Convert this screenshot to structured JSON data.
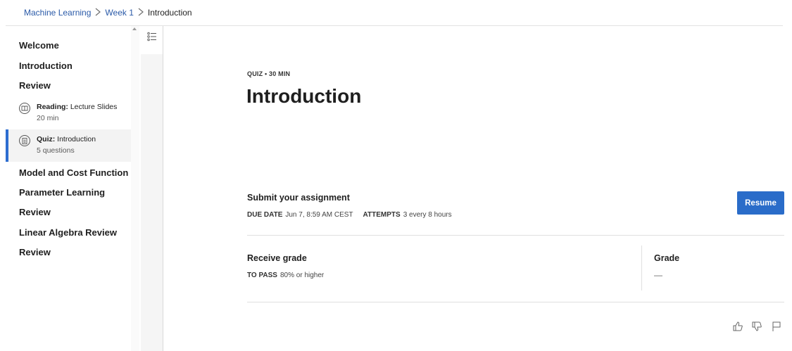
{
  "breadcrumb": {
    "items": [
      "Machine Learning",
      "Week 1"
    ],
    "current": "Introduction"
  },
  "sidebar": {
    "headings_top": [
      "Welcome",
      "Introduction",
      "Review"
    ],
    "lessons": [
      {
        "icon": "reading-icon",
        "type": "Reading:",
        "title": "Lecture Slides",
        "meta": "20 min",
        "selected": false
      },
      {
        "icon": "quiz-icon",
        "type": "Quiz:",
        "title": "Introduction",
        "meta": "5 questions",
        "selected": true
      }
    ],
    "headings_bottom": [
      "Model and Cost Function",
      "Parameter Learning",
      "Review",
      "Linear Algebra Review",
      "Review"
    ]
  },
  "main": {
    "kicker": "QUIZ • 30 MIN",
    "title": "Introduction",
    "submit": {
      "heading": "Submit your assignment",
      "due_label": "DUE DATE",
      "due_value": "Jun 7, 8:59 AM CEST",
      "attempts_label": "ATTEMPTS",
      "attempts_value": "3 every 8 hours",
      "button": "Resume"
    },
    "grade": {
      "heading": "Receive grade",
      "pass_label": "TO PASS",
      "pass_value": "80% or higher",
      "grade_label": "Grade",
      "grade_value": "—"
    }
  },
  "colors": {
    "accent": "#2a6cc9",
    "link": "#2a5aa8",
    "selected_bg": "#f3f3f3"
  },
  "feedback_icons": [
    "thumbs-up-icon",
    "thumbs-down-icon",
    "flag-icon"
  ]
}
